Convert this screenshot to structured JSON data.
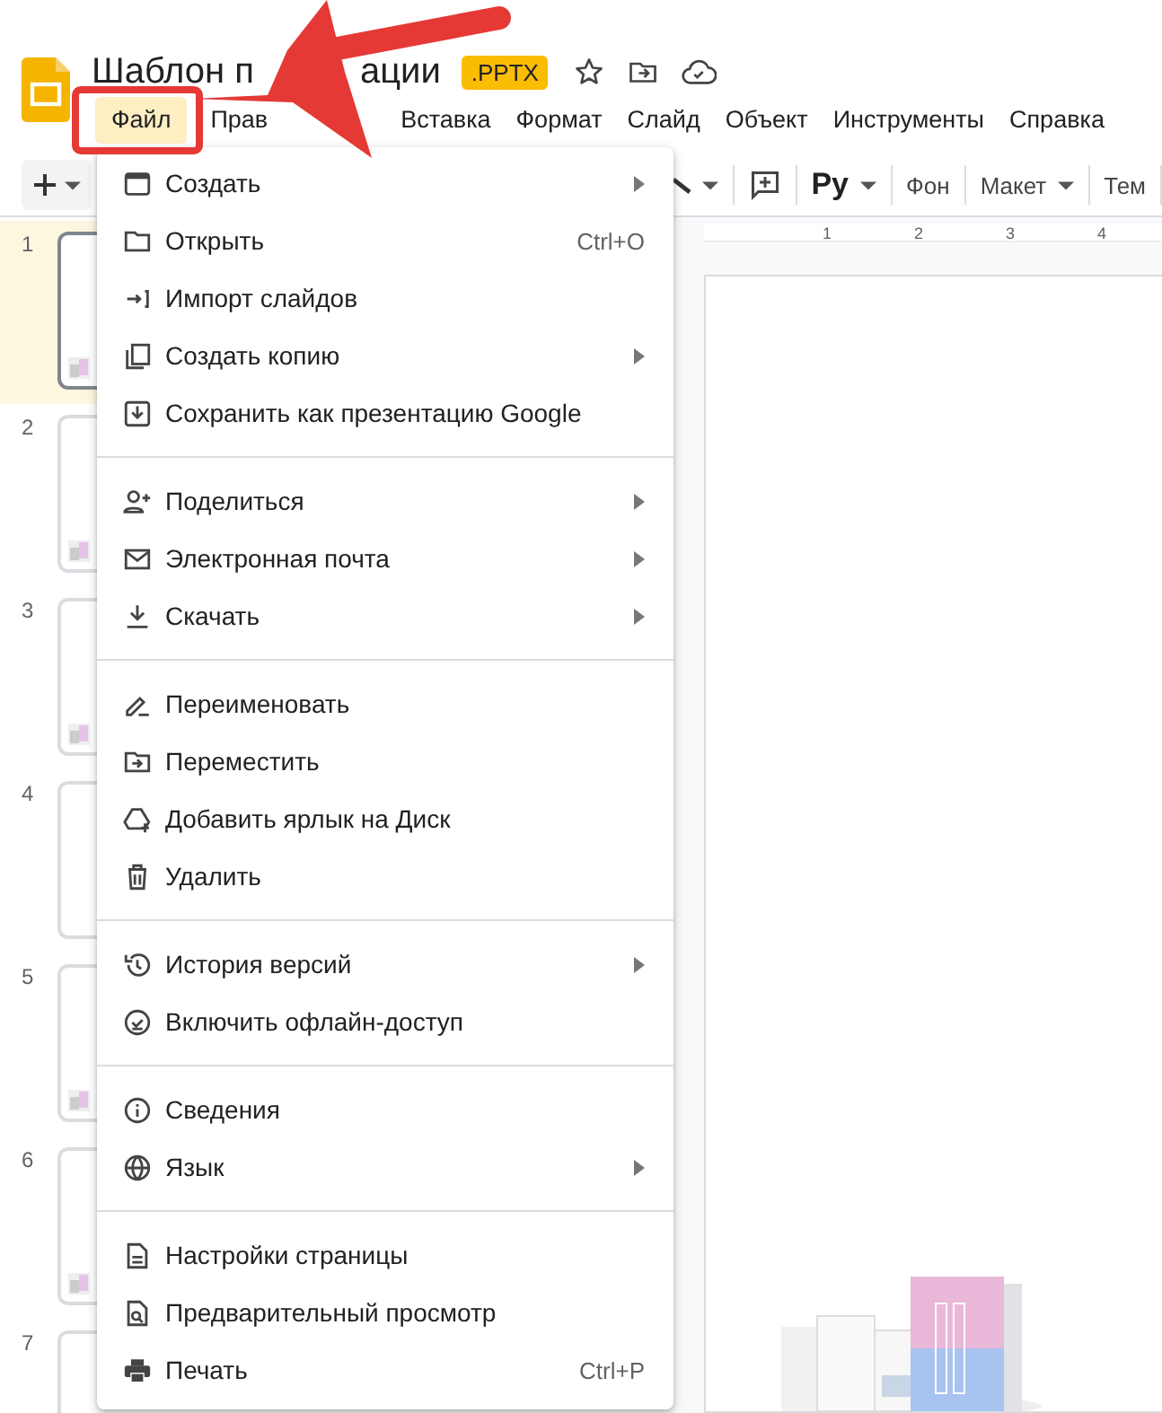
{
  "document": {
    "title_start": "Шаблон п",
    "title_end": "ации",
    "badge": ".PPTX"
  },
  "menubar": [
    {
      "label": "Файл",
      "selected": true
    },
    {
      "label": "Прав",
      "selected": false
    },
    {
      "label": "Вставка",
      "selected": false
    },
    {
      "label": "Формат",
      "selected": false
    },
    {
      "label": "Слайд",
      "selected": false
    },
    {
      "label": "Объект",
      "selected": false
    },
    {
      "label": "Инструменты",
      "selected": false
    },
    {
      "label": "Справка",
      "selected": false
    }
  ],
  "toolbar": [
    {
      "kind": "add"
    },
    {
      "kind": "line"
    },
    {
      "kind": "comment"
    },
    {
      "kind": "input",
      "label": "Ру"
    },
    {
      "kind": "button",
      "label": "Фон"
    },
    {
      "kind": "dropdown",
      "label": "Макет"
    },
    {
      "kind": "button",
      "label": "Тем"
    }
  ],
  "ruler": [
    "1",
    "2",
    "3",
    "4"
  ],
  "slides": [
    {
      "number": "1",
      "selected": true,
      "has_picture": true
    },
    {
      "number": "2",
      "selected": false,
      "has_picture": true
    },
    {
      "number": "3",
      "selected": false,
      "has_picture": true
    },
    {
      "number": "4",
      "selected": false,
      "has_picture": false
    },
    {
      "number": "5",
      "selected": false,
      "has_picture": true
    },
    {
      "number": "6",
      "selected": false,
      "has_picture": true
    },
    {
      "number": "7",
      "selected": false,
      "has_picture": false
    }
  ],
  "file_menu": [
    [
      {
        "kind": "window",
        "label": "Создать",
        "submenu": true
      },
      {
        "kind": "folder",
        "label": "Открыть",
        "shortcut": "Ctrl+O",
        "submenu": false
      },
      {
        "kind": "import",
        "label": "Импорт слайдов",
        "submenu": false
      },
      {
        "kind": "copy",
        "label": "Создать копию",
        "submenu": true
      },
      {
        "kind": "save",
        "label": "Сохранить как презентацию Google",
        "submenu": false
      }
    ],
    [
      {
        "kind": "share",
        "label": "Поделиться",
        "submenu": true
      },
      {
        "kind": "mail",
        "label": "Электронная почта",
        "submenu": true
      },
      {
        "kind": "download",
        "label": "Скачать",
        "submenu": true
      }
    ],
    [
      {
        "kind": "rename",
        "label": "Переименовать",
        "submenu": false
      },
      {
        "kind": "move",
        "label": "Переместить",
        "submenu": false
      },
      {
        "kind": "drive",
        "label": "Добавить ярлык на Диск",
        "submenu": false
      },
      {
        "kind": "trash",
        "label": "Удалить",
        "submenu": false
      }
    ],
    [
      {
        "kind": "history",
        "label": "История версий",
        "submenu": true
      },
      {
        "kind": "offline",
        "label": "Включить офлайн-доступ",
        "submenu": false
      }
    ],
    [
      {
        "kind": "info",
        "label": "Сведения",
        "submenu": false
      },
      {
        "kind": "globe",
        "label": "Язык",
        "submenu": true
      }
    ],
    [
      {
        "kind": "page",
        "label": "Настройки страницы",
        "submenu": false
      },
      {
        "kind": "preview",
        "label": "Предварительный просмотр",
        "submenu": false
      },
      {
        "kind": "print",
        "label": "Печать",
        "shortcut": "Ctrl+P",
        "submenu": false
      }
    ]
  ],
  "canvas": {
    "kind": "picture"
  }
}
